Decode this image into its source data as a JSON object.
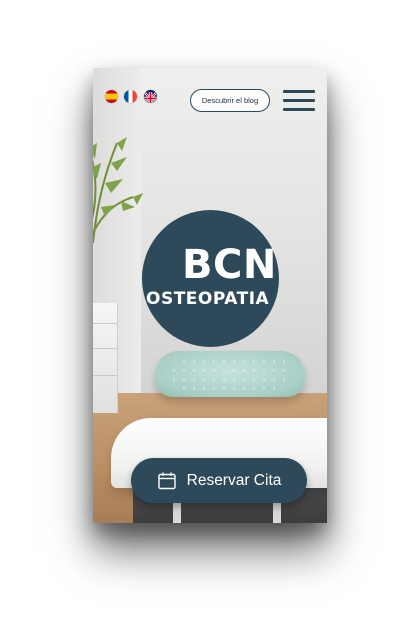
{
  "languages": [
    {
      "code": "es",
      "icon": "spain-flag-icon"
    },
    {
      "code": "fr",
      "icon": "france-flag-icon"
    },
    {
      "code": "en",
      "icon": "uk-flag-icon"
    }
  ],
  "header": {
    "blog_label": "Descubrir el blog",
    "menu_icon": "hamburger-menu-icon"
  },
  "hero": {
    "logo_main": "BCN",
    "logo_sub": "OSTEOPATIA"
  },
  "cta": {
    "label": "Reservar Cita",
    "icon": "calendar-icon"
  },
  "colors": {
    "brand": "#2e4a5a",
    "text_light": "#ffffff",
    "pillow": "#a9cfc6"
  }
}
